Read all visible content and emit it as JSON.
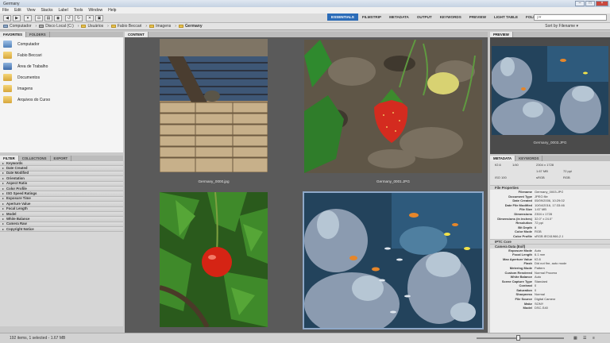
{
  "window": {
    "title": "Germany"
  },
  "menu": [
    "File",
    "Edit",
    "View",
    "Stacks",
    "Label",
    "Tools",
    "Window",
    "Help"
  ],
  "workspaces": {
    "items": [
      "ESSENTIALS",
      "FILMSTRIP",
      "METADATA",
      "OUTPUT",
      "KEYWORDS",
      "PREVIEW",
      "LIGHT TABLE",
      "FOLDERS"
    ],
    "active": "ESSENTIALS"
  },
  "search": {
    "placeholder": "ρ▾"
  },
  "breadcrumb": [
    "Computador",
    "Disco Local (C:)",
    "Usuários",
    "Fabio Beccari",
    "Imagens",
    "Germany"
  ],
  "sort": {
    "label": "Sort by Filename ▾"
  },
  "left_panel": {
    "tabs": [
      "FAVORITES",
      "FOLDERS"
    ],
    "favorites": [
      "Computador",
      "Fabio Beccari",
      "Área de Trabalho",
      "Documentos",
      "Imagens",
      "Arquivos do Curso"
    ]
  },
  "filter_panel": {
    "tabs": [
      "FILTER",
      "COLLECTIONS",
      "EXPORT"
    ],
    "rows": [
      "Keywords",
      "Date Created",
      "Date Modified",
      "Orientation",
      "Aspect Ratio",
      "Color Profile",
      "ISO Speed Ratings",
      "Exposure Time",
      "Aperture Value",
      "Focal Length",
      "Model",
      "White Balance",
      "Camera Raw",
      "Copyright Notice"
    ]
  },
  "content": {
    "tab": "CONTENT",
    "thumbs": [
      {
        "caption": "Germany_0000.jpg"
      },
      {
        "caption": "Germany_0001.JPG"
      },
      {
        "caption": ""
      },
      {
        "caption": ""
      }
    ]
  },
  "preview": {
    "tab": "PREVIEW",
    "caption": "Germany_0003.JPG"
  },
  "metadata_panel": {
    "tabs": [
      "METADATA",
      "KEYWORDS"
    ],
    "summary": {
      "aperture": "f/2.6",
      "shutter": "1/40",
      "dims": "2304 x 1728",
      "size": "1.67 MB",
      "ppi": "72 ppi",
      "iso": "ISO 100",
      "profile": "sRGB",
      "mode": "RGB"
    },
    "file_properties_title": "File Properties",
    "file_properties": [
      {
        "k": "Filename",
        "v": "Germany_0003.JPG"
      },
      {
        "k": "Document Type",
        "v": "JPEG file"
      },
      {
        "k": "Date Created",
        "v": "05/09/2006, 10:29:02"
      },
      {
        "k": "Date File Modified",
        "v": "10/04/2016, 17:33:46"
      },
      {
        "k": "File Size",
        "v": "1.67 MB"
      },
      {
        "k": "Dimensions",
        "v": "2304 x 1728"
      },
      {
        "k": "Dimensions (in inches)",
        "v": "32.0\" x 24.0\""
      },
      {
        "k": "Resolution",
        "v": "72 ppi"
      },
      {
        "k": "Bit Depth",
        "v": "8"
      },
      {
        "k": "Color Mode",
        "v": "RGB"
      },
      {
        "k": "Color Profile",
        "v": "sRGB IEC61966-2.1"
      }
    ],
    "iptc_title": "IPTC Core",
    "camera_title": "Camera Data (Exif)",
    "camera_data": [
      {
        "k": "Exposure Mode",
        "v": "Auto"
      },
      {
        "k": "Focal Length",
        "v": "6.1 mm"
      },
      {
        "k": "Max Aperture Value",
        "v": "f/2.8"
      },
      {
        "k": "Flash",
        "v": "Did not fire, auto mode"
      },
      {
        "k": "Metering Mode",
        "v": "Pattern"
      },
      {
        "k": "Custom Rendered",
        "v": "Normal Process"
      },
      {
        "k": "White Balance",
        "v": "Auto"
      },
      {
        "k": "Scene Capture Type",
        "v": "Standard"
      },
      {
        "k": "Contrast",
        "v": "0"
      },
      {
        "k": "Saturation",
        "v": "0"
      },
      {
        "k": "Sharpness",
        "v": "Normal"
      },
      {
        "k": "File Source",
        "v": "Digital Camera"
      },
      {
        "k": "Make",
        "v": "SONY"
      },
      {
        "k": "Model",
        "v": "DSC-S40"
      }
    ]
  },
  "status": {
    "text": "192 items, 1 selected - 1.67 MB"
  }
}
